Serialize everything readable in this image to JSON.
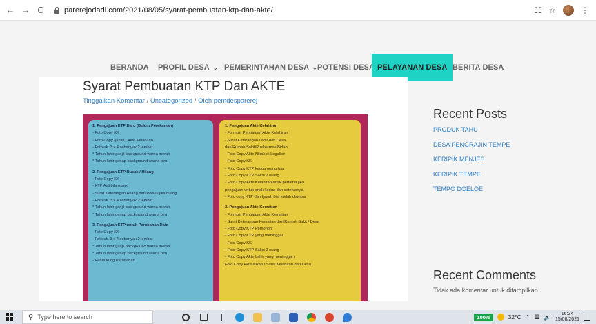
{
  "browser": {
    "url": "parerejodadi.com/2021/08/05/syarat-pembuatan-ktp-dan-akte/",
    "back_icon": "←",
    "forward_icon": "→",
    "reload_icon": "C"
  },
  "nav": {
    "items": [
      {
        "label": "BERANDA",
        "dropdown": false
      },
      {
        "label": "PROFIL DESA",
        "dropdown": true
      },
      {
        "label": "PEMERINTAHAN DESA",
        "dropdown": true
      },
      {
        "label": "POTENSI DESA",
        "dropdown": false
      },
      {
        "label": "PELAYANAN DESA",
        "dropdown": false,
        "active": true
      },
      {
        "label": "BERITA DESA",
        "dropdown": false
      }
    ],
    "active_color": "#1ed3c3"
  },
  "post": {
    "title": "Syarat Pembuatan KTP Dan AKTE",
    "meta_comment": "Tinggalkan Komentar",
    "meta_category": "Uncategorized",
    "meta_author_prefix": "Oleh",
    "meta_author": "pemdesparerej",
    "meta_separator": "/"
  },
  "photo": {
    "left_lines": [
      {
        "text": "1. Pengajuan KTP Baru (Belum Perekaman)",
        "head": true
      },
      {
        "text": "- Foto Copy KK"
      },
      {
        "text": "- Foto Copy Ijazah / Akte Kelahiran"
      },
      {
        "text": "- Foto uk. 3 x 4 sebanyak 2 lembar"
      },
      {
        "text": "* Tahun lahir ganjil background warna merah"
      },
      {
        "text": "* Tahun lahir genap background warna biru"
      },
      {
        "text": "",
        "gap": true
      },
      {
        "text": "2. Pengajuan KTP Rusak / Hilang",
        "head": true
      },
      {
        "text": "- Foto Copy KK"
      },
      {
        "text": "- KTP Asli bila rusak"
      },
      {
        "text": "- Surat Keterangan Hilang dari Polsek jika hilang"
      },
      {
        "text": "- Foto uk. 3 x 4 sebanyak 2 lembar"
      },
      {
        "text": "* Tahun lahir ganjil background warna merah"
      },
      {
        "text": "* Tahun lahir genap background warna biru"
      },
      {
        "text": "",
        "gap": true
      },
      {
        "text": "3. Pengajuan KTP untuk Perubahan Data",
        "head": true
      },
      {
        "text": "- Foto Copy KK"
      },
      {
        "text": "- Foto uk. 3 x 4 sebanyak 2 lembar"
      },
      {
        "text": "* Tahun lahir ganjil background warna merah"
      },
      {
        "text": "* Tahun lahir genap background warna biru"
      },
      {
        "text": "- Pendukung Perubahan"
      }
    ],
    "right_lines": [
      {
        "text": "1. Pengajuan Akte Kelahiran",
        "head": true
      },
      {
        "text": "- Formulir Pengajuan Akte Kelahiran"
      },
      {
        "text": "- Surat Keterangan Lahir dari Desa"
      },
      {
        "text": "dan Rumah Sakit/Puskesmas/Bidan"
      },
      {
        "text": "- Foto Copy Akte Nikah di Legalisir"
      },
      {
        "text": "- Foto Copy KK"
      },
      {
        "text": "- Foto Copy KTP kedua orang tua"
      },
      {
        "text": "- Foto Copy KTP Saksi 2 orang"
      },
      {
        "text": "- Foto Copy Akte Kelahiran anak pertama jika"
      },
      {
        "text": "pengajuan untuk anak kedua dan seterusnya"
      },
      {
        "text": "- Foto copy KTP dan Ijazah bila sudah dewasa"
      },
      {
        "text": "",
        "gap": true
      },
      {
        "text": "2. Pengajuan Akte Kematian",
        "head": true
      },
      {
        "text": "- Formulir Pengajuan Akte Kematian"
      },
      {
        "text": "- Surat Keterangan Kematian dari Rumah Sakit / Desa"
      },
      {
        "text": "- Foto Copy KTP Pemohon"
      },
      {
        "text": "- Foto Copy KTP yang meninggal"
      },
      {
        "text": "- Foto Copy KK"
      },
      {
        "text": "- Foto Copy KTP Saksi 2 orang"
      },
      {
        "text": "- Foto Copy Akte Lahir yang meninggal /"
      },
      {
        "text": "Foto Copy Akte Nikah / Surat Kelahiran dari Desa"
      }
    ]
  },
  "sidebar": {
    "recent_posts_title": "Recent Posts",
    "recent_posts": [
      "PRODUK TAHU",
      "DESA PENGRAJIN TEMPE",
      "KERIPIK MENJES",
      "KERIPIK TEMPE",
      "TEMPO DOELOE"
    ],
    "recent_comments_title": "Recent Comments",
    "recent_comments_empty": "Tidak ada komentar untuk ditampilkan."
  },
  "taskbar": {
    "search_placeholder": "Type here to search",
    "battery": "100%",
    "temperature": "32°C",
    "time": "16:24",
    "date": "15/08/2021"
  }
}
